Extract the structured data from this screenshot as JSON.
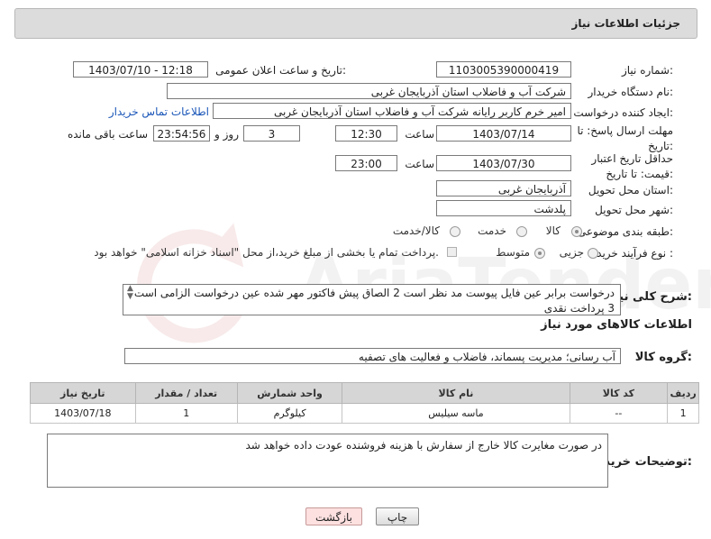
{
  "header": {
    "title": "جزئیات اطلاعات نیاز"
  },
  "form": {
    "need_number": {
      "label": "شماره نیاز:",
      "value": "1103005390000419"
    },
    "announce_datetime": {
      "label": "تاریخ و ساعت اعلان عمومی:",
      "value": "1403/07/10 - 12:18"
    },
    "buyer_org": {
      "label": "نام دستگاه خریدار:",
      "value": "شرکت آب و فاضلاب استان آذربایجان غربی"
    },
    "requester": {
      "label": "ایجاد کننده درخواست:",
      "value": "امیر خرم کاربر رایانه شرکت آب و فاضلاب استان آذربایجان غربی",
      "contact_link": "اطلاعات تماس خریدار"
    },
    "reply_deadline": {
      "label": "مهلت ارسال پاسخ: تا تاریخ:",
      "date": "1403/07/14",
      "time_label": "ساعت",
      "time": "12:30",
      "days": "3",
      "days_label": "روز و",
      "remaining": "23:54:56",
      "remaining_label": "ساعت باقی مانده"
    },
    "price_validity": {
      "label": "حداقل تاریخ اعتبار قیمت: تا تاریخ:",
      "date": "1403/07/30",
      "time_label": "ساعت",
      "time": "23:00"
    },
    "delivery_province": {
      "label": "استان محل تحویل:",
      "value": "آذربایجان غربی"
    },
    "delivery_city": {
      "label": "شهر محل تحویل:",
      "value": "پلدشت"
    },
    "category": {
      "label": "طبقه بندی موضوعی:",
      "options": [
        "کالا",
        "خدمت",
        "کالا/خدمت"
      ],
      "selected": "کالا"
    },
    "purchase_process": {
      "label": "نوع فرآیند خرید :",
      "options": [
        "جزیی",
        "متوسط"
      ],
      "selected": "متوسط",
      "note": "پرداخت تمام یا بخشی از مبلغ خرید،از محل \"اسناد خزانه اسلامی\" خواهد بود."
    }
  },
  "description": {
    "label": "شرح کلی نیاز:",
    "line1": "درخواست برابر عین فایل پیوست مد نظر است 2 الصاق پیش فاکتور مهر شده عین درخواست الزامی است",
    "line2": "3 پرداخت نقدی"
  },
  "items_section": {
    "title": "اطلاعات کالاهای مورد نیاز",
    "group_label": "گروه کالا:",
    "group_value": "آب رسانی؛ مدیریت پسماند، فاضلاب و فعالیت های تصفیه",
    "columns": [
      "ردیف",
      "کد کالا",
      "نام کالا",
      "واحد شمارش",
      "تعداد / مقدار",
      "تاریخ نیاز"
    ],
    "rows": [
      {
        "row": "1",
        "code": "--",
        "name": "ماسه سیلیس",
        "unit": "کیلوگرم",
        "qty": "1",
        "date": "1403/07/18"
      }
    ]
  },
  "buyer_notes": {
    "label": "توضیحات خریدار:",
    "value": "در صورت مغایرت کالا خارج از سفارش با هزینه فروشنده عودت داده خواهد شد"
  },
  "buttons": {
    "print": "چاپ",
    "back": "بازگشت"
  },
  "colors": {
    "link": "#1a56b8",
    "back_button_bg": "#fde0e0",
    "header_bg": "#dcdcdc"
  }
}
